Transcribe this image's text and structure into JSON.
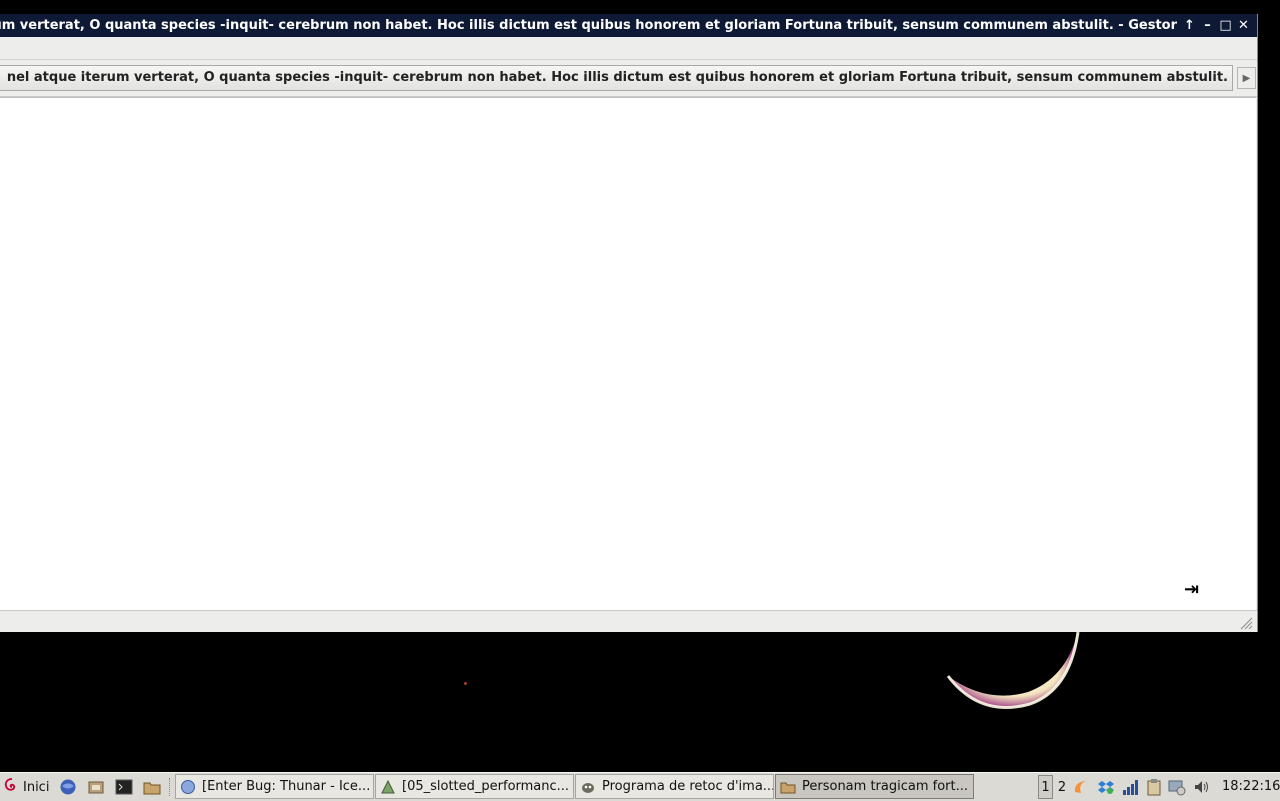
{
  "window": {
    "title": "que iterum verterat, O quanta species -inquit- cerebrum non habet.  Hoc illis dictum est quibus honorem et gloriam Fortuna tribuit, sensum communem abstulit. - Gestor",
    "buttons": {
      "rollup": "↑",
      "minimize": "–",
      "maximize": "□",
      "close": "✕"
    }
  },
  "location": {
    "path": "nel atque iterum verterat, O quanta species -inquit- cerebrum non habet.  Hoc illis dictum est quibus honorem et gloriam Fortuna tribuit, sensum communem abstulit.",
    "scroll_right_icon": "▶"
  },
  "content": {
    "cursor_icon": "⇥"
  },
  "taskbar": {
    "start_label": "Inici",
    "tasks": [
      {
        "label": "[Enter Bug: Thunar - Ice...",
        "icon": "iceweasel-icon"
      },
      {
        "label": "[05_slotted_performanc...",
        "icon": "image-viewer-icon"
      },
      {
        "label": "Programa de retoc d'ima...",
        "icon": "gimp-icon"
      },
      {
        "label": "Personam tragicam fort...",
        "icon": "folder-icon",
        "active": true
      }
    ],
    "workspaces": [
      "1",
      "2"
    ],
    "clock": "18:22:16"
  },
  "colors": {
    "titlebar": "#0e1a35",
    "window_bg": "#ededeb",
    "taskbar_bg": "#dcdad5",
    "desktop": "#000000"
  }
}
